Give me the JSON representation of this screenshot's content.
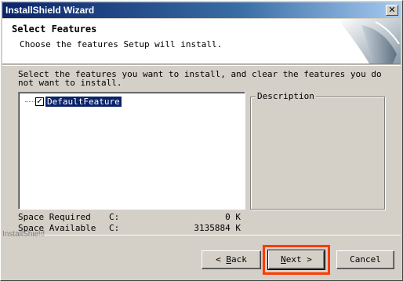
{
  "window": {
    "title": "InstallShield Wizard",
    "close_symbol": "✕"
  },
  "header": {
    "title": "Select Features",
    "subtitle": "Choose the features Setup will install."
  },
  "instructions": "Select the features you want to install, and clear the features you do not want to install.",
  "tree": {
    "items": [
      {
        "label": "DefaultFeature",
        "checked": true,
        "check_symbol": "✓"
      }
    ]
  },
  "description": {
    "legend": "Description"
  },
  "space": {
    "required_label": "Space Required",
    "required_drive": "C:",
    "required_value": "0 K",
    "available_label": "Space Available",
    "available_drive": "C:",
    "available_value": "3135884 K"
  },
  "brand": "InstallShield",
  "buttons": {
    "back_prefix": "< ",
    "back_hotkey": "B",
    "back_rest": "ack",
    "next_hotkey": "N",
    "next_rest": "ext >",
    "cancel": "Cancel"
  },
  "colors": {
    "highlight": "#ff3a00",
    "title_start": "#0a246a",
    "title_end": "#a6caf0",
    "selection": "#0a246a"
  }
}
